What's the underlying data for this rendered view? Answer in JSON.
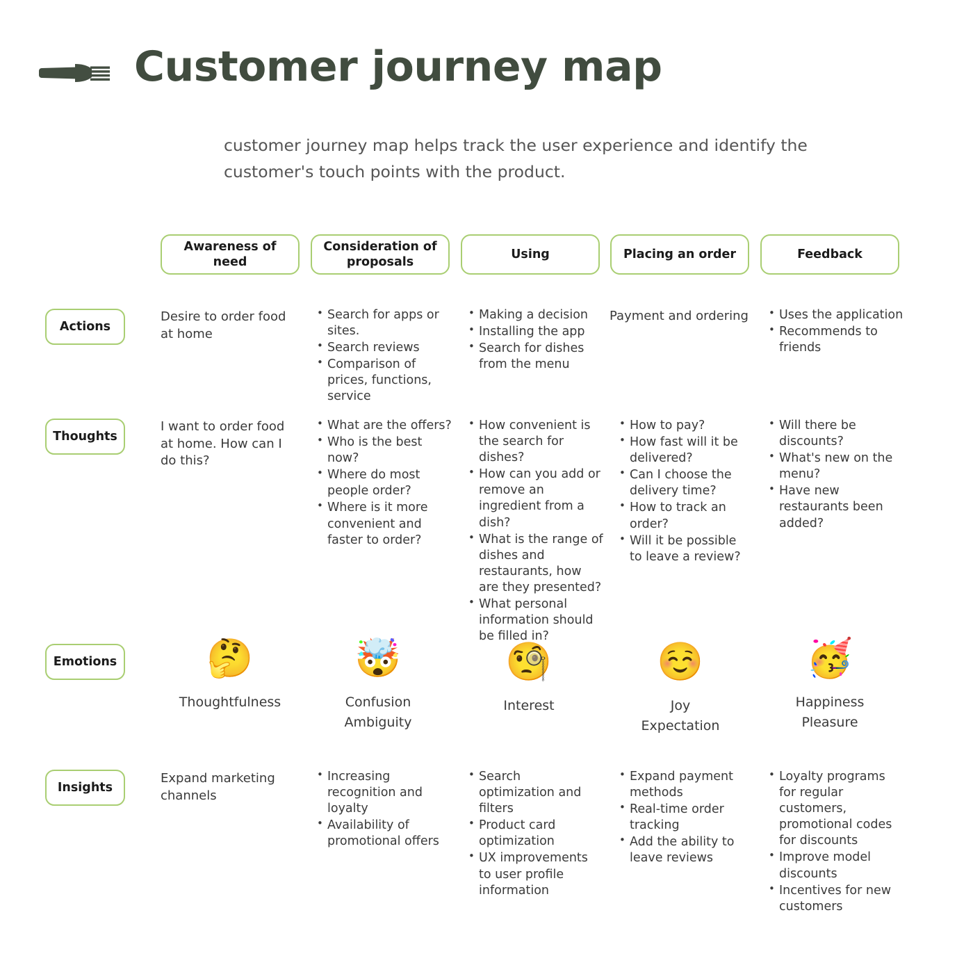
{
  "header": {
    "title": "Customer journey map",
    "subtitle": "customer journey map helps track the user experience and identify the customer's touch points with the product.",
    "icon": "fork-icon"
  },
  "theme": {
    "accent_green": "#a9ce72",
    "title_color": "#414c3f",
    "text_color": "#3a3a3a",
    "subtitle_color": "#555555",
    "background": "#ffffff"
  },
  "stages": [
    {
      "label": "Awareness of need"
    },
    {
      "label": "Consideration of proposals"
    },
    {
      "label": "Using"
    },
    {
      "label": "Placing an order"
    },
    {
      "label": "Feedback"
    }
  ],
  "rows": [
    {
      "label": "Actions",
      "cells": [
        {
          "type": "plain",
          "text": "Desire to order food at home"
        },
        {
          "type": "list",
          "items": [
            "Search for apps or sites.",
            "Search reviews",
            "Comparison of prices, functions, service"
          ]
        },
        {
          "type": "list",
          "items": [
            "Making a decision",
            "Installing the app",
            "Search for dishes from the menu"
          ]
        },
        {
          "type": "plain",
          "text": "Payment and ordering"
        },
        {
          "type": "list",
          "items": [
            "Uses the application",
            "Recommends to friends"
          ]
        }
      ]
    },
    {
      "label": "Thoughts",
      "cells": [
        {
          "type": "plain",
          "text": "I want to order food at home. How can I do this?"
        },
        {
          "type": "list",
          "items": [
            "What are the offers?",
            "Who is the best now?",
            "Where do most people order?",
            "Where is it more convenient and faster to order?"
          ]
        },
        {
          "type": "list",
          "items": [
            "How convenient is the search for dishes?",
            "How can you add or remove an ingredient from a dish?",
            "What is the range of dishes and restaurants, how are they presented?",
            "What personal information should be filled in?"
          ]
        },
        {
          "type": "list",
          "items": [
            "How to pay?",
            "How fast will it be delivered?",
            "Can I choose the delivery time?",
            "How to track an order?",
            "Will it be possible to leave a review?"
          ]
        },
        {
          "type": "list",
          "items": [
            "Will there be discounts?",
            "What's new on the menu?",
            "Have new restaurants been added?"
          ]
        }
      ]
    },
    {
      "label": "Emotions",
      "cells": [
        {
          "type": "emotion",
          "emoji": "🤔",
          "icon": "thinking-face-emoji",
          "label": "Thoughtfulness"
        },
        {
          "type": "emotion",
          "emoji": "🤯",
          "icon": "exploding-head-emoji",
          "label": "Confusion\nAmbiguity"
        },
        {
          "type": "emotion",
          "emoji": "🧐",
          "icon": "monocle-face-emoji",
          "label": "Interest"
        },
        {
          "type": "emotion",
          "emoji": "☺️",
          "icon": "smiling-face-emoji",
          "label": "Joy\nExpectation"
        },
        {
          "type": "emotion",
          "emoji": "🥳",
          "icon": "partying-face-emoji",
          "label": "Happiness\nPleasure"
        }
      ]
    },
    {
      "label": "Insights",
      "cells": [
        {
          "type": "plain",
          "text": "Expand marketing channels"
        },
        {
          "type": "list",
          "items": [
            "Increasing recognition and loyalty",
            "Availability of promotional offers"
          ]
        },
        {
          "type": "list",
          "items": [
            "Search optimization and filters",
            "Product card optimization",
            "UX improvements to user profile information"
          ]
        },
        {
          "type": "list",
          "items": [
            "Expand payment methods",
            "Real-time order tracking",
            "Add the ability to leave reviews"
          ]
        },
        {
          "type": "list",
          "items": [
            "Loyalty programs for regular customers, promotional codes for discounts",
            "Improve model discounts",
            "Incentives for new customers"
          ]
        }
      ]
    }
  ]
}
